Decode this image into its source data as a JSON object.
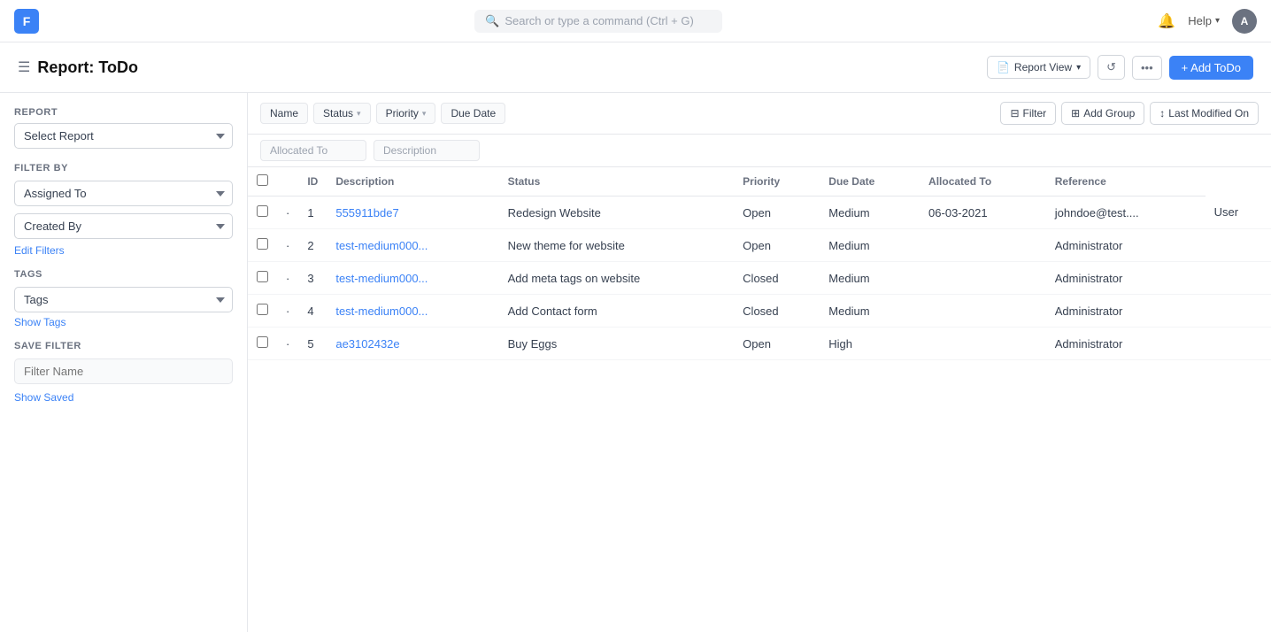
{
  "app": {
    "logo": "F",
    "search_placeholder": "Search or type a command (Ctrl + G)"
  },
  "nav": {
    "help_label": "Help",
    "avatar_label": "A"
  },
  "page": {
    "title": "Report: ToDo",
    "report_view_label": "Report View",
    "refresh_icon": "↺",
    "more_icon": "•••",
    "add_todo_label": "+ Add ToDo"
  },
  "sidebar": {
    "report_section_label": "Report",
    "select_report_placeholder": "Select Report",
    "filter_by_label": "Filter By",
    "assigned_to_label": "Assigned To",
    "created_by_label": "Created By",
    "edit_filters_label": "Edit Filters",
    "tags_label": "Tags",
    "tags_placeholder": "Tags",
    "show_tags_label": "Show Tags",
    "save_filter_label": "Save Filter",
    "filter_name_placeholder": "Filter Name",
    "show_saved_label": "Show Saved"
  },
  "toolbar": {
    "name_filter_label": "Name",
    "status_filter_label": "Status",
    "priority_filter_label": "Priority",
    "due_date_filter_label": "Due Date",
    "allocated_to_filter_label": "Allocated To",
    "description_filter_label": "Description",
    "filter_btn_label": "Filter",
    "add_group_btn_label": "Add Group",
    "sort_label": "Last Modified On"
  },
  "table": {
    "columns": [
      "",
      "",
      "ID",
      "Description",
      "Status",
      "Priority",
      "Due Date",
      "Allocated To",
      "Reference"
    ],
    "rows": [
      {
        "num": 1,
        "id": "555911bde7",
        "description": "Redesign Website",
        "status": "Open",
        "priority": "Medium",
        "due_date": "06-03-2021",
        "allocated_to": "johndoe@test....",
        "reference": "User"
      },
      {
        "num": 2,
        "id": "test-medium000...",
        "description": "New theme for website",
        "status": "Open",
        "priority": "Medium",
        "due_date": "",
        "allocated_to": "Administrator",
        "reference": ""
      },
      {
        "num": 3,
        "id": "test-medium000...",
        "description": "Add meta tags on website",
        "status": "Closed",
        "priority": "Medium",
        "due_date": "",
        "allocated_to": "Administrator",
        "reference": ""
      },
      {
        "num": 4,
        "id": "test-medium000...",
        "description": "Add Contact form",
        "status": "Closed",
        "priority": "Medium",
        "due_date": "",
        "allocated_to": "Administrator",
        "reference": ""
      },
      {
        "num": 5,
        "id": "ae3102432e",
        "description": "Buy Eggs",
        "status": "Open",
        "priority": "High",
        "due_date": "",
        "allocated_to": "Administrator",
        "reference": ""
      }
    ]
  }
}
